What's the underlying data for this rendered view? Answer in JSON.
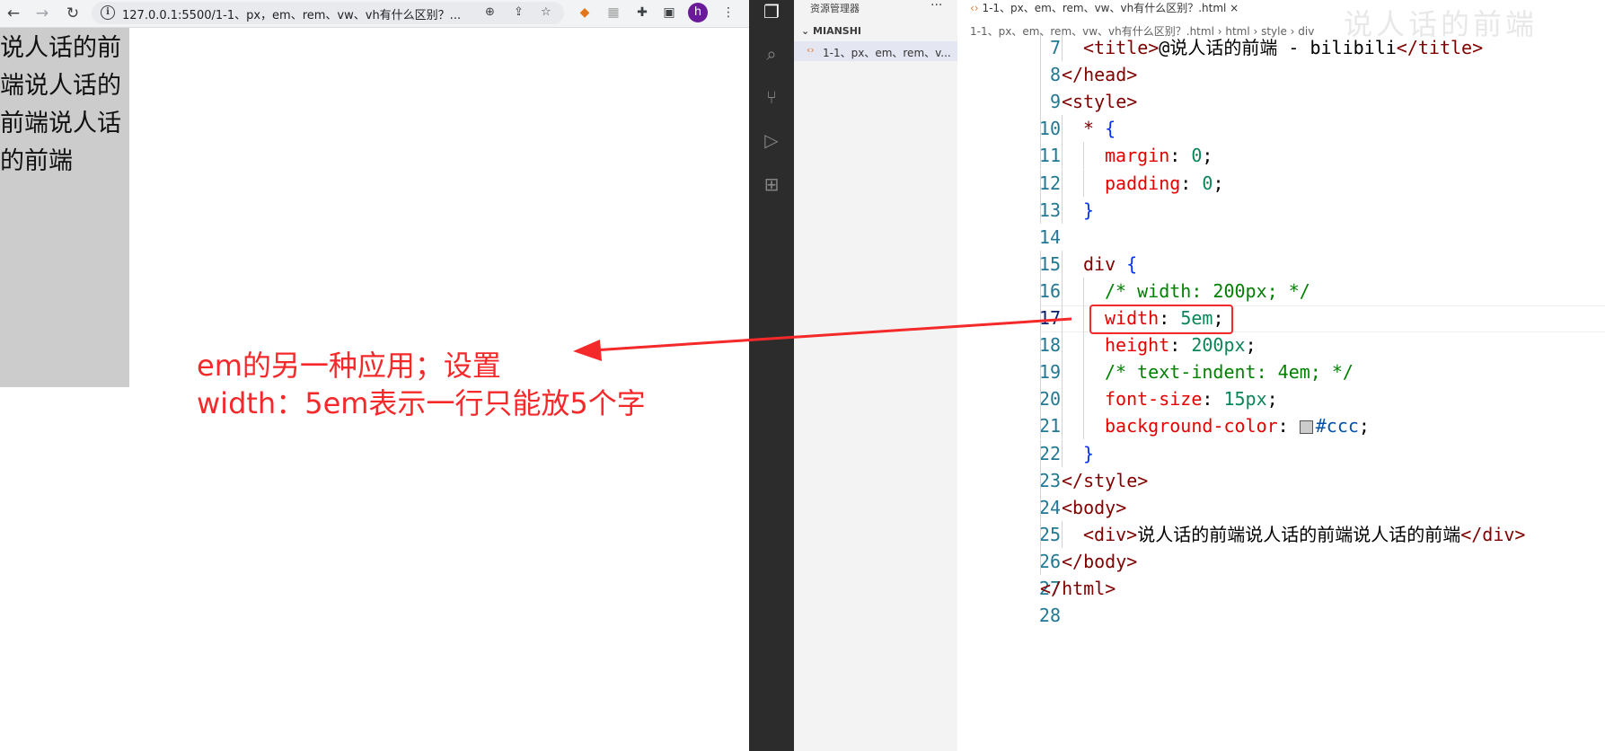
{
  "browser": {
    "url": "127.0.0.1:5500/1-1、px，em、rem、vw、vh有什么区别？...",
    "profile_initial": "h",
    "div_text": "说人话的前端说人话的前端说人话的前端",
    "annotation_line1": "em的另一种应用；设置",
    "annotation_line2": "width：5em表示一行只能放5个字",
    "annotation_color": "#f5282a"
  },
  "explorer": {
    "title": "资源管理器",
    "menu": "···",
    "folder": "MIANSHI",
    "file": "1-1、px、em、rem、v..."
  },
  "editor": {
    "tab_label": "1-1、px、em、rem、vw、vh有什么区别？.html",
    "tab_close": "×",
    "breadcrumb": "1-1、px、em、rem、vw、vh有什么区别？.html  ›  html  ›  style  ›  div",
    "watermark": "说人话的前端",
    "active_line": 17,
    "lines": [
      {
        "n": "7",
        "text": "<title>@说人话的前端 - bilibili</title>"
      },
      {
        "n": "8",
        "text": "</head>"
      },
      {
        "n": "9",
        "text": "<style>"
      },
      {
        "n": "10",
        "text": "* {"
      },
      {
        "n": "11",
        "text": "margin: 0;"
      },
      {
        "n": "12",
        "text": "padding: 0;"
      },
      {
        "n": "13",
        "text": "}"
      },
      {
        "n": "14",
        "text": ""
      },
      {
        "n": "15",
        "text": "div {"
      },
      {
        "n": "16",
        "text": "/* width: 200px; */"
      },
      {
        "n": "17",
        "text": "width: 5em;"
      },
      {
        "n": "18",
        "text": "height: 200px;"
      },
      {
        "n": "19",
        "text": "/* text-indent: 4em; */"
      },
      {
        "n": "20",
        "text": "font-size: 15px;"
      },
      {
        "n": "21",
        "text": "background-color: #ccc;"
      },
      {
        "n": "22",
        "text": "}"
      },
      {
        "n": "23",
        "text": "</style>"
      },
      {
        "n": "24",
        "text": "<body>"
      },
      {
        "n": "25",
        "text": "<div>说人话的前端说人话的前端说人话的前端</div>"
      },
      {
        "n": "26",
        "text": "</body>"
      },
      {
        "n": "27",
        "text": "</html>"
      },
      {
        "n": "28",
        "text": ""
      }
    ]
  },
  "colors": {
    "activity_bar": "#2c2c2c",
    "sidebar": "#f3f3f3",
    "div_background": "#cccccc",
    "highlight": "#f5282a"
  }
}
